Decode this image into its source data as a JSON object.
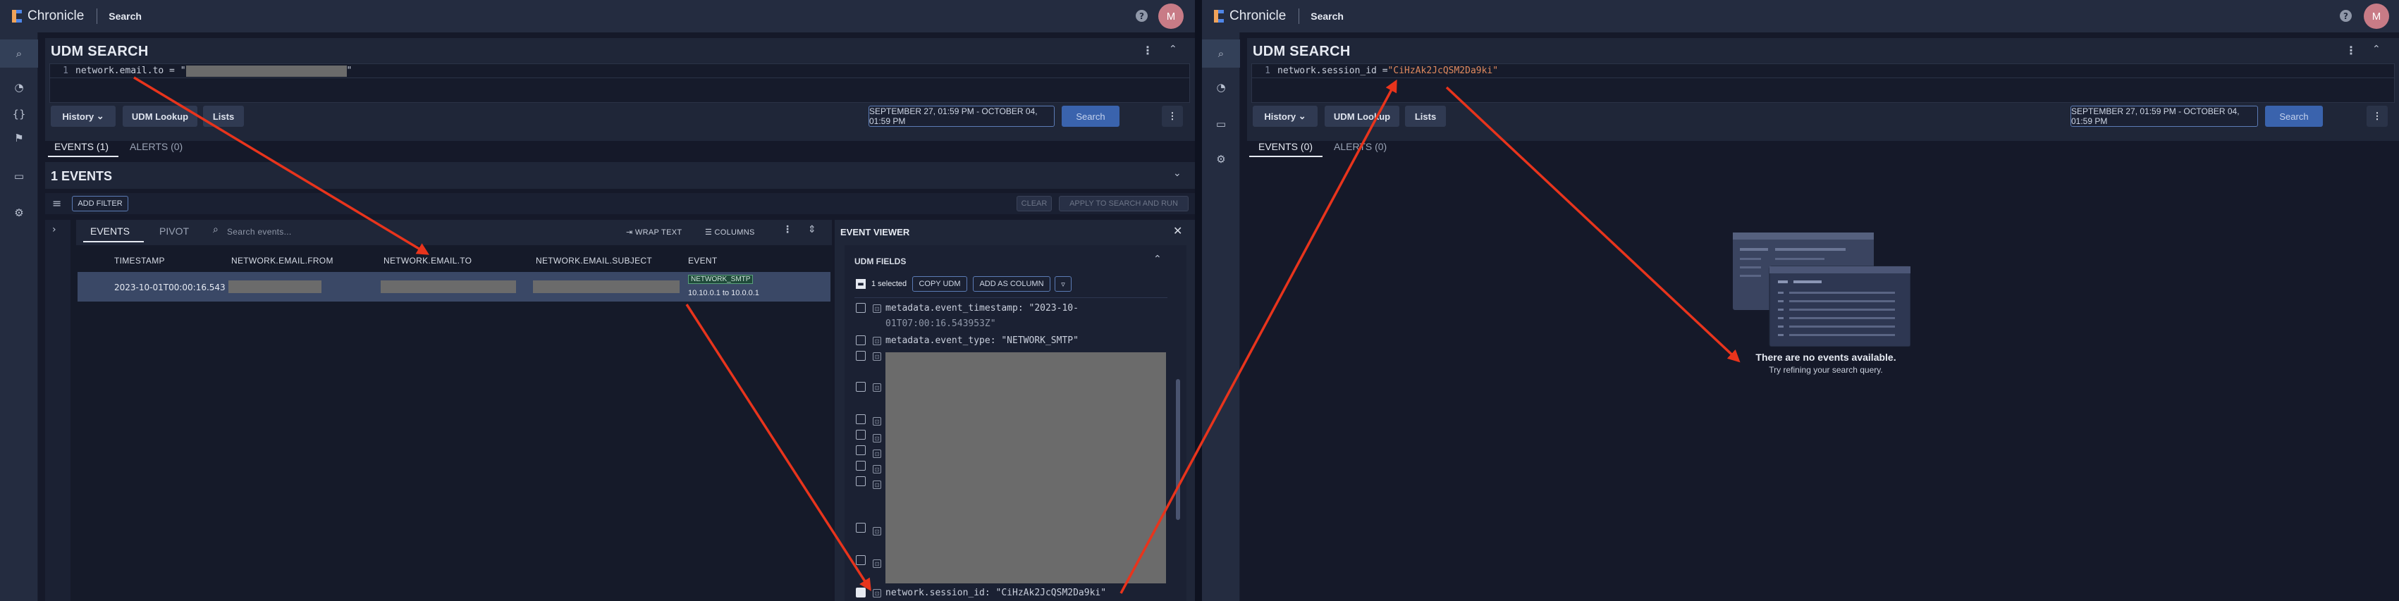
{
  "app": {
    "name": "Chronicle",
    "page": "Search",
    "help": "?",
    "user_initial": "M"
  },
  "left": {
    "header": "UDM SEARCH",
    "query": {
      "line_number": "1",
      "prefix": "network.email.to = \"",
      "suffix": "\""
    },
    "toolbar": {
      "history": "History",
      "udm_lookup": "UDM Lookup",
      "lists": "Lists",
      "date_range": "SEPTEMBER 27, 01:59 PM - OCTOBER 04, 01:59 PM",
      "search": "Search"
    },
    "tabs": [
      {
        "label": "EVENTS (1)"
      },
      {
        "label": "ALERTS (0)"
      }
    ],
    "count_title": "1 EVENTS",
    "filters": {
      "add_filter": "ADD FILTER",
      "clear": "CLEAR",
      "apply": "APPLY TO SEARCH AND RUN"
    },
    "results": {
      "tabs": [
        {
          "label": "EVENTS"
        },
        {
          "label": "PIVOT"
        }
      ],
      "search_placeholder": "Search events...",
      "wrap_text": "WRAP TEXT",
      "columns": "COLUMNS",
      "headers": [
        "TIMESTAMP",
        "NETWORK.EMAIL.FROM",
        "NETWORK.EMAIL.TO",
        "NETWORK.EMAIL.SUBJECT",
        "EVENT"
      ],
      "row": {
        "timestamp": "2023-10-01T00:00:16.543",
        "event_type": "NETWORK_SMTP",
        "event_detail": "10.10.0.1 to 10.0.0.1"
      }
    },
    "viewer": {
      "title": "EVENT VIEWER",
      "section": "UDM FIELDS",
      "selected": "1 selected",
      "copy_udm": "COPY UDM",
      "add_as_column": "ADD AS COLUMN",
      "field_1a": "metadata.event_timestamp: \"2023-10-",
      "field_1b": "01T07:00:16.543953Z\"",
      "field_2": "metadata.event_type: \"NETWORK_SMTP\"",
      "field_last": "network.session_id: \"CiHzAk2JcQSM2Da9ki\""
    }
  },
  "right": {
    "header": "UDM SEARCH",
    "query": {
      "line_number": "1",
      "prefix": "network.session_id = ",
      "value": "\"CiHzAk2JcQSM2Da9ki\""
    },
    "toolbar": {
      "history": "History",
      "udm_lookup": "UDM Lookup",
      "lists": "Lists",
      "date_range": "SEPTEMBER 27, 01:59 PM - OCTOBER 04, 01:59 PM",
      "search": "Search"
    },
    "tabs": [
      {
        "label": "EVENTS (0)"
      },
      {
        "label": "ALERTS (0)"
      }
    ],
    "empty": {
      "title": "There are no events available.",
      "subtitle": "Try refining your search query."
    }
  },
  "colors": {
    "arrow": "#e8341c",
    "accent": "#3a63ad",
    "topbar": "#242c40"
  }
}
